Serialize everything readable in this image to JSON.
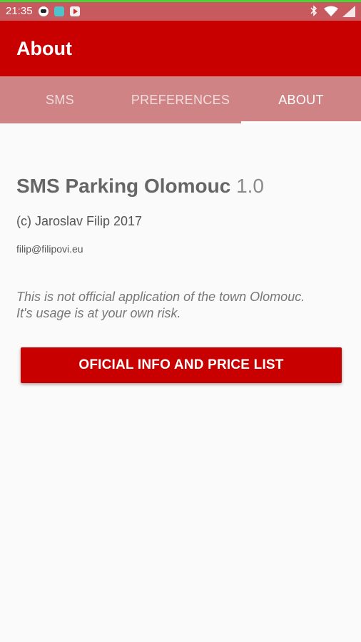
{
  "status_bar": {
    "time": "21:35",
    "icons": [
      "panda-notification-icon",
      "app-notification-icon",
      "play-notification-icon",
      "bluetooth-icon",
      "wifi-icon",
      "signal-icon"
    ],
    "bar_color": "#c75a5e"
  },
  "appbar": {
    "title": "About",
    "color": "#c80000"
  },
  "tabs": [
    {
      "label": "SMS",
      "active": false
    },
    {
      "label": "PREFERENCES",
      "active": false
    },
    {
      "label": "ABOUT",
      "active": true
    }
  ],
  "about": {
    "app_name": "SMS Parking Olomouc",
    "version": "1.0",
    "copyright": "(c) Jaroslav Filip 2017",
    "email": "filip@filipovi.eu",
    "disclaimer_line1": "This is not official application of the town Olomouc.",
    "disclaimer_line2": "It's usage is at your own risk."
  },
  "actions": {
    "info_button_label": "OFICIAL INFO AND PRICE LIST"
  }
}
